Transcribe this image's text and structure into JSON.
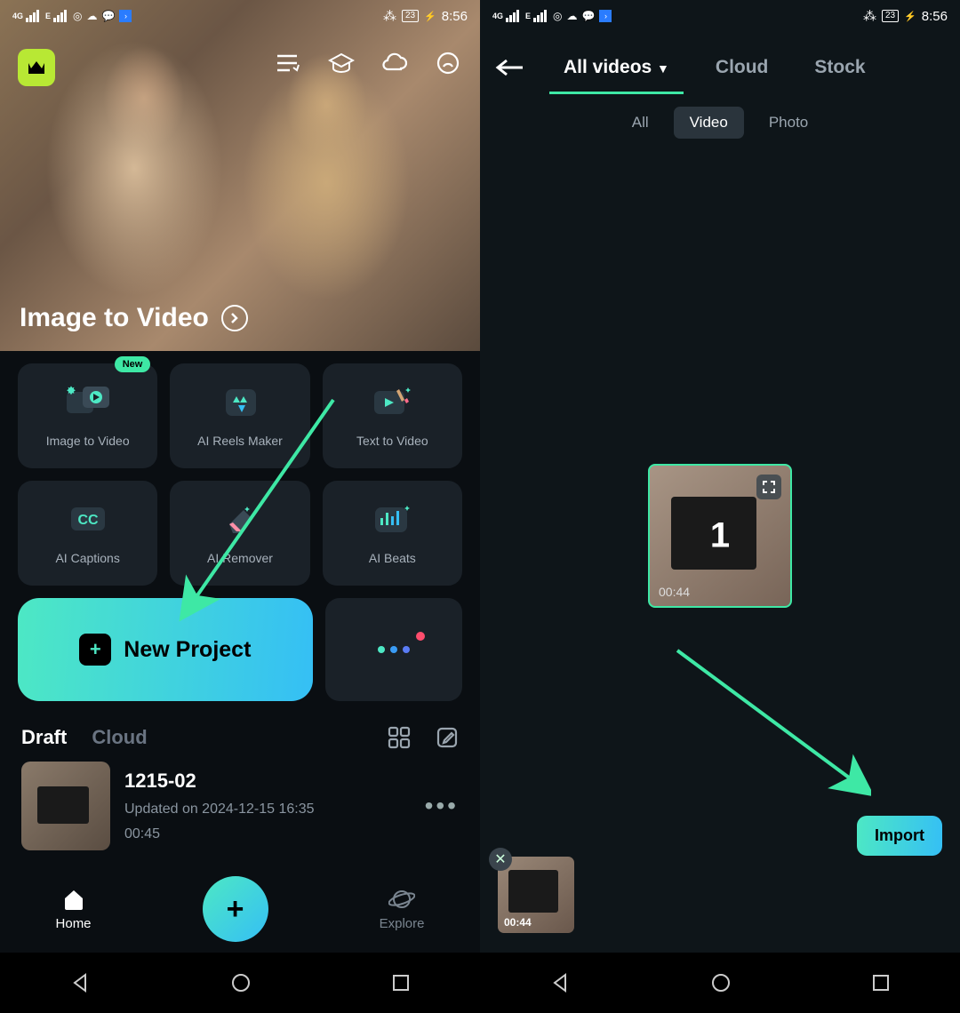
{
  "status": {
    "network": "4G",
    "edge": "E",
    "battery": "23",
    "time": "8:56"
  },
  "screenA": {
    "hero_title": "Image to Video",
    "tools": [
      "Image to Video",
      "AI Reels Maker",
      "Text to Video",
      "AI Captions",
      "AI Remover",
      "AI Beats"
    ],
    "badge_new": "New",
    "new_project": "New Project",
    "draft_tabs": {
      "draft": "Draft",
      "cloud": "Cloud"
    },
    "draft": {
      "title": "1215-02",
      "updated": "Updated on 2024-12-15 16:35",
      "duration": "00:45"
    },
    "nav": {
      "home": "Home",
      "explore": "Explore"
    }
  },
  "screenB": {
    "source_tabs": {
      "all": "All videos",
      "cloud": "Cloud",
      "stock": "Stock"
    },
    "filter": {
      "all": "All",
      "video": "Video",
      "photo": "Photo"
    },
    "selected_num": "1",
    "video_duration": "00:44",
    "sel_duration": "00:44",
    "import": "Import"
  }
}
